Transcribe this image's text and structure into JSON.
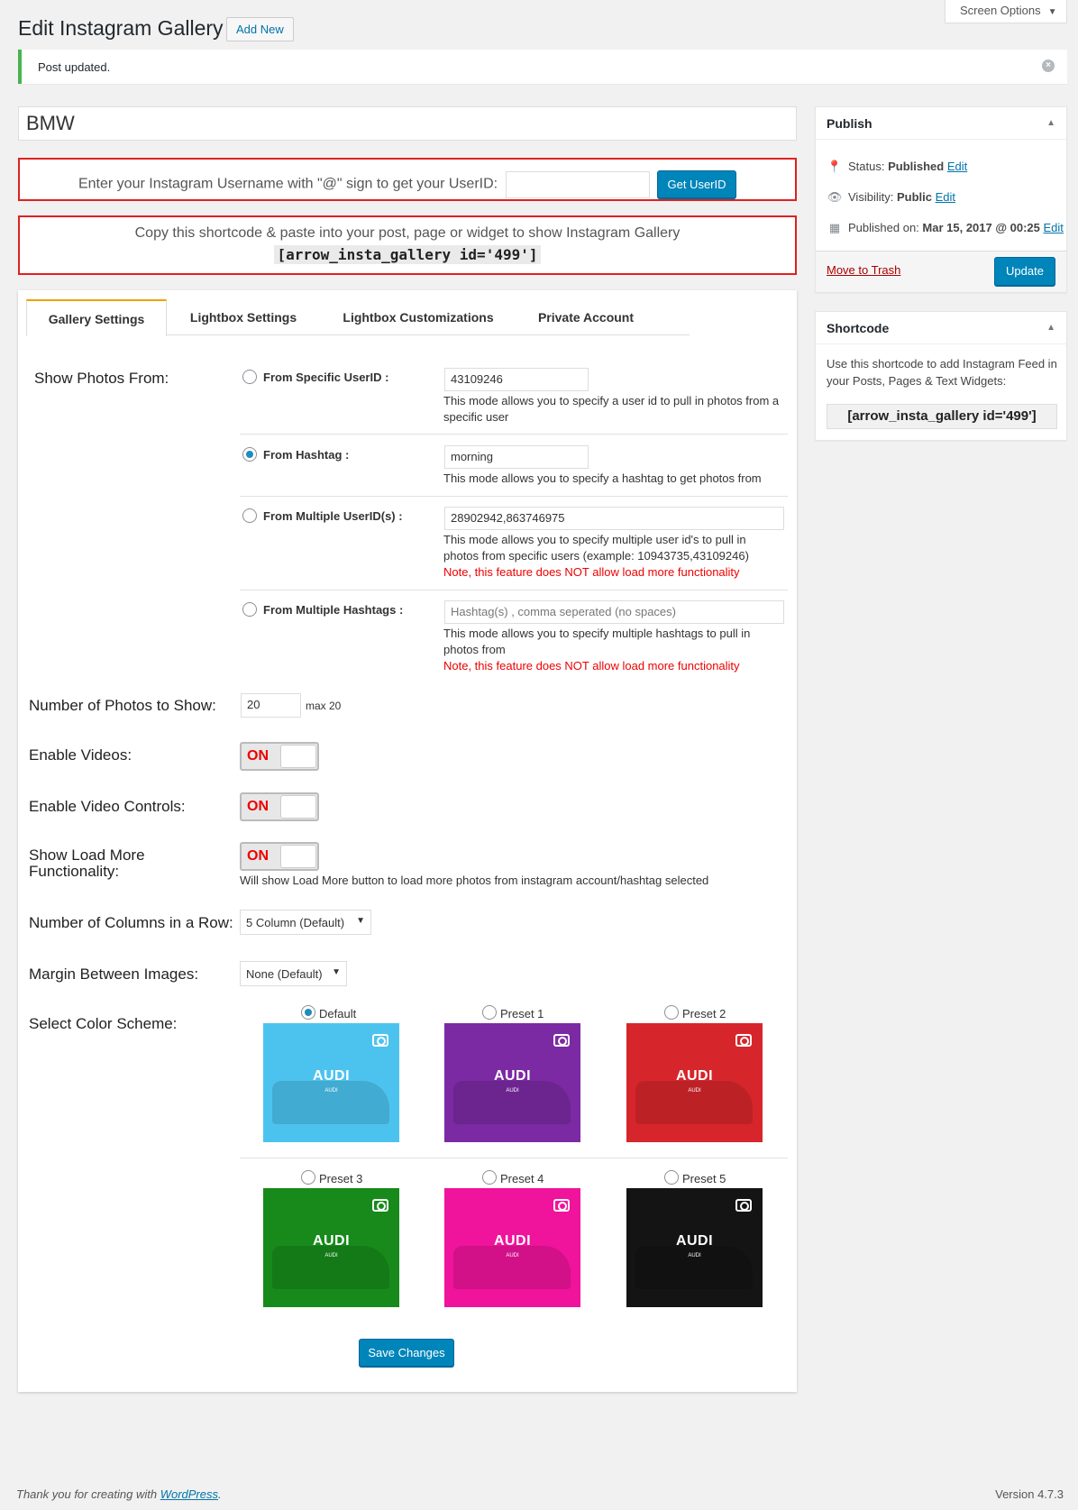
{
  "header": {
    "screen_options": "Screen Options",
    "title": "Edit Instagram Gallery",
    "add_new": "Add New",
    "notice": "Post updated."
  },
  "post": {
    "title": "BMW"
  },
  "userid_box": {
    "label": "Enter your Instagram Username with \"@\" sign to get your UserID:",
    "input_value": "",
    "button": "Get UserID"
  },
  "shortcode_box": {
    "text": "Copy this shortcode & paste into your post, page or widget to show Instagram Gallery",
    "code": "[arrow_insta_gallery id='499']"
  },
  "tabs": [
    {
      "label": "Gallery Settings",
      "active": true
    },
    {
      "label": "Lightbox Settings",
      "active": false
    },
    {
      "label": "Lightbox Customizations",
      "active": false
    },
    {
      "label": "Private Account",
      "active": false
    }
  ],
  "show_photos": {
    "label": "Show Photos From:",
    "options": [
      {
        "label": "From Specific UserID :",
        "value": "43109246",
        "placeholder": "",
        "desc": "This mode allows you to specify a user id to pull in photos from a specific user",
        "note": "",
        "checked": false
      },
      {
        "label": "From Hashtag :",
        "value": "morning",
        "placeholder": "",
        "desc": "This mode allows you to specify a hashtag to get photos from",
        "note": "",
        "checked": true
      },
      {
        "label": "From Multiple UserID(s) :",
        "value": "28902942,863746975",
        "placeholder": "",
        "desc": "This mode allows you to specify multiple user id's to pull in photos from specific users (example: 10943735,43109246)",
        "note": "Note, this feature does NOT allow load more functionality",
        "checked": false
      },
      {
        "label": "From Multiple Hashtags :",
        "value": "",
        "placeholder": "Hashtag(s) , comma seperated (no spaces)",
        "desc": "This mode allows you to specify multiple hashtags to pull in photos from",
        "note": "Note, this feature does NOT allow load more functionality",
        "checked": false
      }
    ]
  },
  "num_photos": {
    "label": "Number of Photos to Show:",
    "value": "20",
    "hint": "max 20"
  },
  "enable_videos": {
    "label": "Enable Videos:",
    "state": "ON"
  },
  "enable_video_controls": {
    "label": "Enable Video Controls:",
    "state": "ON"
  },
  "load_more": {
    "label": "Show Load More Functionality:",
    "state": "ON",
    "desc": "Will show Load More button to load more photos from instagram account/hashtag selected"
  },
  "columns": {
    "label": "Number of Columns in a Row:",
    "value": "5 Column (Default)"
  },
  "margin": {
    "label": "Margin Between Images:",
    "value": "None (Default)"
  },
  "color_scheme": {
    "label": "Select Color Scheme:",
    "presets": [
      {
        "label": "Default",
        "color": "#4cc3ef",
        "checked": true,
        "brand": "AUDI",
        "sub": "AUDI"
      },
      {
        "label": "Preset 1",
        "color": "#7b2aa3",
        "checked": false,
        "brand": "AUDI",
        "sub": "AUDI"
      },
      {
        "label": "Preset 2",
        "color": "#d6262c",
        "checked": false,
        "brand": "AUDI",
        "sub": "AUDI"
      },
      {
        "label": "Preset 3",
        "color": "#178a1b",
        "checked": false,
        "brand": "AUDI",
        "sub": "AUDI"
      },
      {
        "label": "Preset 4",
        "color": "#f0139b",
        "checked": false,
        "brand": "AUDI",
        "sub": "AUDI"
      },
      {
        "label": "Preset 5",
        "color": "#141414",
        "checked": false,
        "brand": "AUDI",
        "sub": "AUDI"
      }
    ]
  },
  "save_button": "Save Changes",
  "publish": {
    "title": "Publish",
    "status_label": "Status:",
    "status_value": "Published",
    "visibility_label": "Visibility:",
    "visibility_value": "Public",
    "published_label": "Published on:",
    "published_value": "Mar 15, 2017 @ 00:25",
    "edit": "Edit",
    "trash": "Move to Trash",
    "update": "Update"
  },
  "shortcode_widget": {
    "title": "Shortcode",
    "desc": "Use this shortcode to add Instagram Feed in your Posts, Pages & Text Widgets:",
    "code": "[arrow_insta_gallery id='499']"
  },
  "footer": {
    "thanks": "Thank you for creating with",
    "link": "WordPress",
    "version": "Version 4.7.3"
  }
}
